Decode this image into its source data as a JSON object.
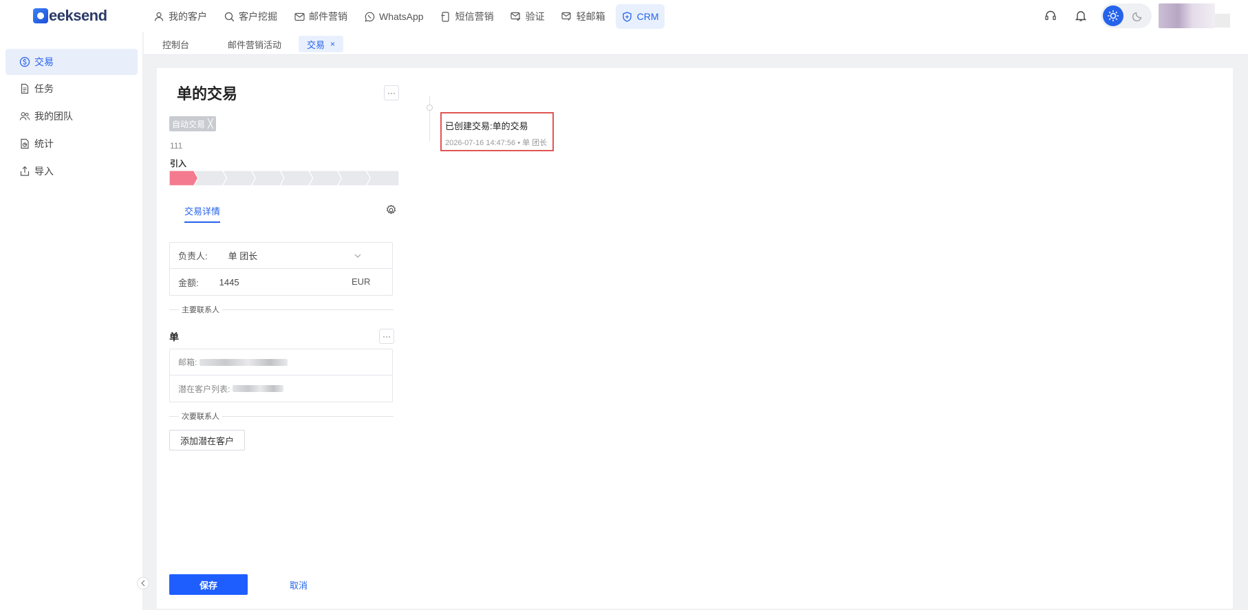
{
  "app": {
    "logo_text": "eeksend"
  },
  "nav": {
    "items": [
      {
        "label": "我的客户",
        "icon": "user-icon"
      },
      {
        "label": "客户挖掘",
        "icon": "search-icon"
      },
      {
        "label": "邮件营销",
        "icon": "mail-icon"
      },
      {
        "label": "WhatsApp",
        "icon": "whatsapp-icon"
      },
      {
        "label": "短信营销",
        "icon": "sms-icon"
      },
      {
        "label": "验证",
        "icon": "verify-mail-icon"
      },
      {
        "label": "轻邮箱",
        "icon": "light-mail-icon"
      },
      {
        "label": "CRM",
        "icon": "crm-icon",
        "active": true
      }
    ]
  },
  "sidebar": {
    "items": [
      {
        "label": "交易",
        "icon": "dollar-circle-icon",
        "active": true
      },
      {
        "label": "任务",
        "icon": "document-icon"
      },
      {
        "label": "我的团队",
        "icon": "team-icon"
      },
      {
        "label": "统计",
        "icon": "stats-icon"
      },
      {
        "label": "导入",
        "icon": "import-icon"
      }
    ]
  },
  "tabs": [
    {
      "label": "控制台"
    },
    {
      "label": "邮件营销活动"
    },
    {
      "label": "交易",
      "active": true,
      "close": "×"
    }
  ],
  "deal": {
    "title": "单的交易",
    "more": "···",
    "tag": "自动交易",
    "tag_close": "╳",
    "number": "111",
    "stage_label": "引入",
    "stage_total": 8,
    "stage_current": 1,
    "detail_tab": "交易详情",
    "owner_label": "负责人:",
    "owner_value": "单 团长",
    "amount_label": "金额:",
    "amount_value": "1445",
    "currency": "EUR",
    "primary_contact_label": "主要联系人",
    "contact_name": "单",
    "contact_more": "···",
    "email_label": "邮箱:",
    "lead_list_label": "潜在客户列表:",
    "secondary_contact_label": "次要联系人",
    "add_lead_button": "添加潜在客户",
    "save_button": "保存",
    "cancel_button": "取消"
  },
  "timeline": {
    "entry_title": "已创建交易:单的交易",
    "entry_time": "2026-07-16 14:47:56",
    "entry_user": "• 单 团长"
  },
  "colors": {
    "accent": "#2563eb",
    "save_button": "#1e5eff",
    "stage_active": "#f47a8f",
    "stage_inactive": "#e7e9ec",
    "highlight_border": "#e25353"
  }
}
